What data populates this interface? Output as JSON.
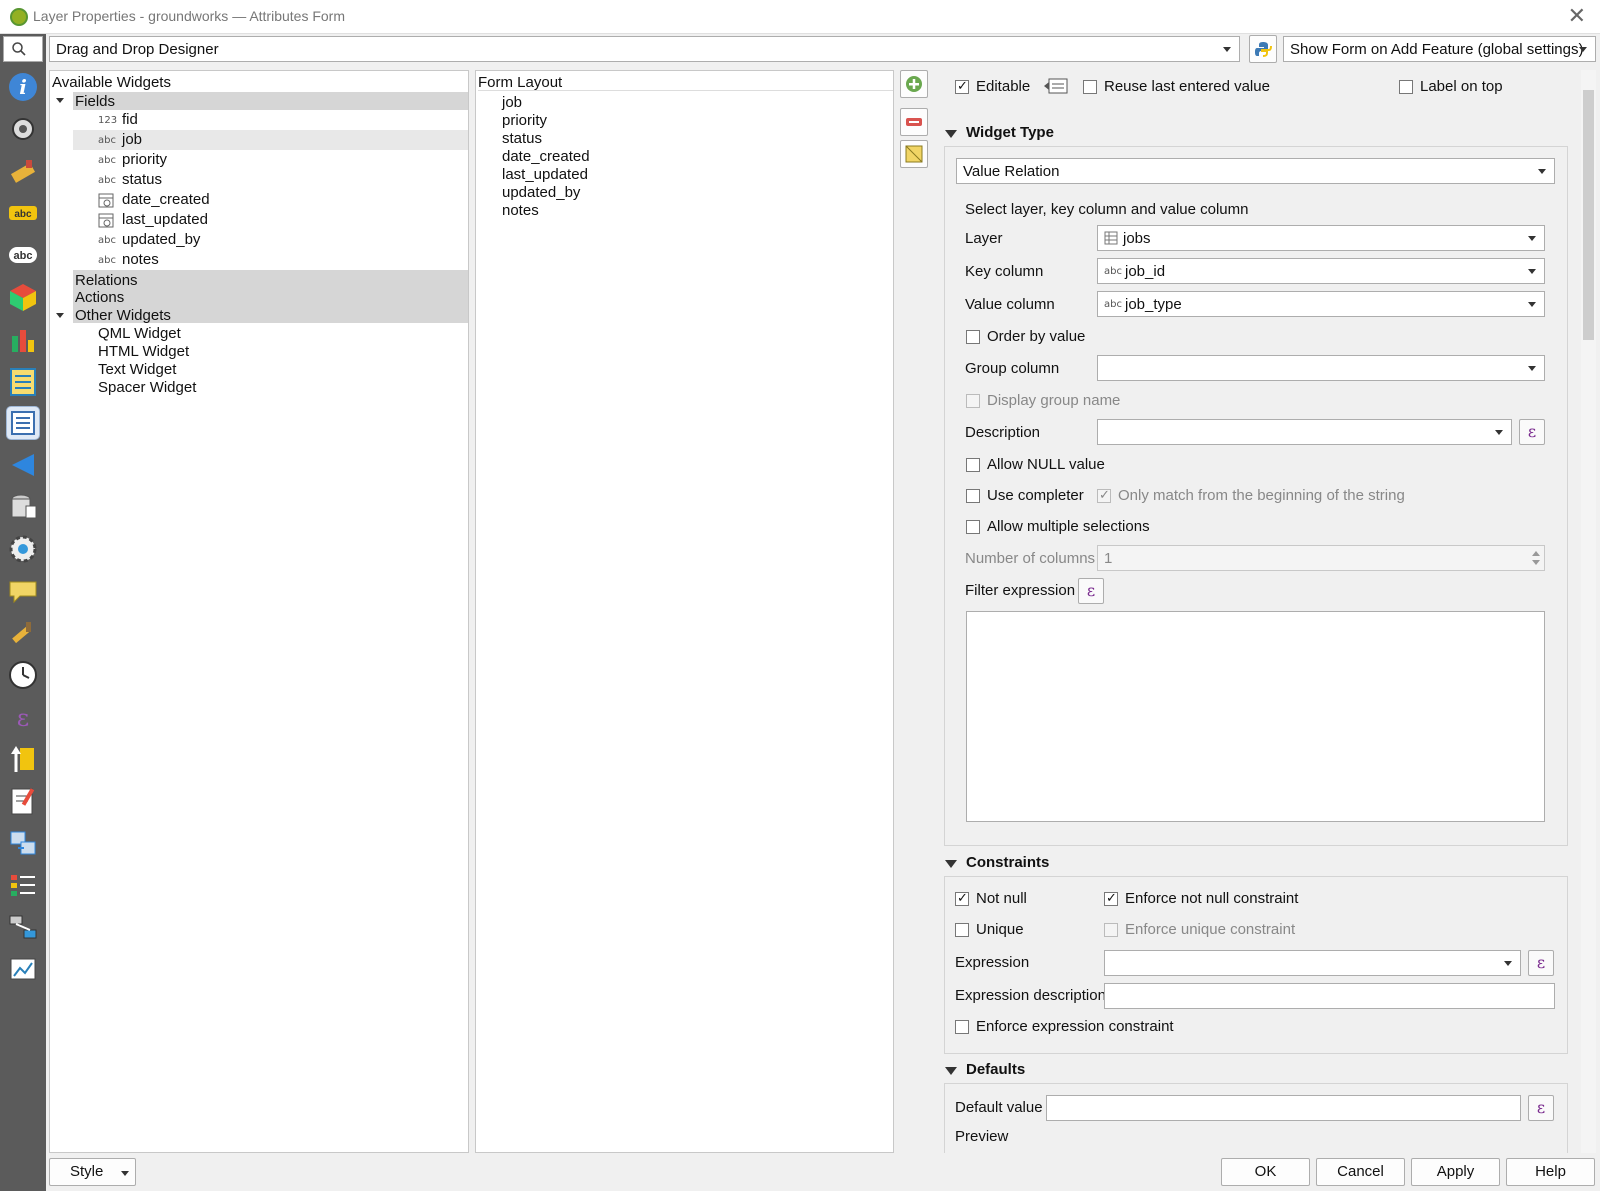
{
  "window": {
    "title": "Layer Properties - groundworks — Attributes Form",
    "close": "✕"
  },
  "toolbar": {
    "designer_mode": "Drag and Drop Designer",
    "show_form": "Show Form on Add Feature (global settings)"
  },
  "available_widgets": {
    "header": "Available Widgets",
    "fields_label": "Fields",
    "fields": [
      {
        "icon": "123",
        "name": "fid"
      },
      {
        "icon": "abc",
        "name": "job"
      },
      {
        "icon": "abc",
        "name": "priority"
      },
      {
        "icon": "abc",
        "name": "status"
      },
      {
        "icon": "date",
        "name": "date_created"
      },
      {
        "icon": "date",
        "name": "last_updated"
      },
      {
        "icon": "abc",
        "name": "updated_by"
      },
      {
        "icon": "abc",
        "name": "notes"
      }
    ],
    "relations": "Relations",
    "actions": "Actions",
    "other_widgets": "Other Widgets",
    "other_items": [
      "QML Widget",
      "HTML Widget",
      "Text Widget",
      "Spacer Widget"
    ]
  },
  "form_layout": {
    "header": "Form Layout",
    "items": [
      "job",
      "priority",
      "status",
      "date_created",
      "last_updated",
      "updated_by",
      "notes"
    ]
  },
  "general": {
    "editable": "Editable",
    "reuse": "Reuse last entered value",
    "label_on_top": "Label on top"
  },
  "widget_type": {
    "header": "Widget Type",
    "value": "Value Relation",
    "intro": "Select layer, key column and value column",
    "layer_label": "Layer",
    "layer_value": "jobs",
    "key_label": "Key column",
    "key_value": "job_id",
    "value_label": "Value column",
    "value_value": "job_type",
    "order_by_value": "Order by value",
    "group_label": "Group column",
    "display_group": "Display group name",
    "description_label": "Description",
    "allow_null": "Allow NULL value",
    "use_completer": "Use completer",
    "only_match": "Only match from the beginning of the string",
    "allow_multiple": "Allow multiple selections",
    "num_columns_label": "Number of columns",
    "num_columns_value": "1",
    "filter_label": "Filter expression"
  },
  "constraints": {
    "header": "Constraints",
    "not_null": "Not null",
    "enforce_not_null": "Enforce not null constraint",
    "unique": "Unique",
    "enforce_unique": "Enforce unique constraint",
    "expression_label": "Expression",
    "expression_desc_label": "Expression description",
    "enforce_expression": "Enforce expression constraint"
  },
  "defaults": {
    "header": "Defaults",
    "default_value_label": "Default value",
    "preview_label": "Preview"
  },
  "footer": {
    "style": "Style",
    "ok": "OK",
    "cancel": "Cancel",
    "apply": "Apply",
    "help": "Help"
  },
  "epsilon": "ε",
  "abc": "abc",
  "colors": {
    "sidebar": "#5b5b5b",
    "selection": "#d6d6d6",
    "epsilon": "#7a2b8e"
  }
}
